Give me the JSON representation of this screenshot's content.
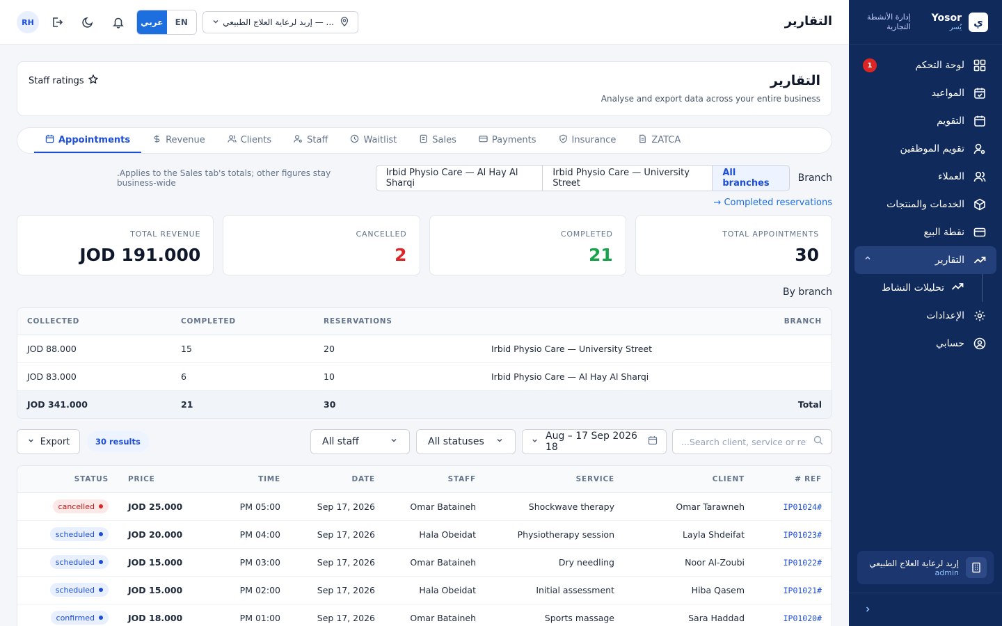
{
  "app": {
    "brand_name": "Yosor",
    "brand_name_ar": "يُسر",
    "brand_logo_glyph": "ي",
    "brand_subtitle_1": "إدارة الأنشطة",
    "brand_subtitle_2": "التجارية"
  },
  "topbar": {
    "avatar": "RH",
    "lang_ar": "عربي",
    "lang_en": "EN",
    "branch_selector": "إربد لرعاية العلاج الطبيعي — ...",
    "page_title": "التقارير"
  },
  "sidebar": {
    "items": [
      {
        "label": "لوحة التحكم",
        "icon": "dashboard-icon",
        "badge": "1"
      },
      {
        "label": "المواعيد",
        "icon": "calendar-check-icon"
      },
      {
        "label": "التقويم",
        "icon": "calendar-icon"
      },
      {
        "label": "تقويم الموظفين",
        "icon": "user-gear-icon"
      },
      {
        "label": "العملاء",
        "icon": "users-icon"
      },
      {
        "label": "الخدمات والمنتجات",
        "icon": "box-icon"
      },
      {
        "label": "نقطة البيع",
        "icon": "credit-card-icon"
      },
      {
        "label": "التقارير",
        "icon": "trending-up-icon",
        "active": true
      },
      {
        "label": "تحليلات النشاط",
        "icon": "trending-up-icon",
        "sub": true
      },
      {
        "label": "الإعدادات",
        "icon": "gear-icon"
      },
      {
        "label": "حسابي",
        "icon": "user-circle-icon"
      }
    ],
    "branch_card": {
      "name": "إربد لرعاية العلاج الطبيعي",
      "role": "admin"
    }
  },
  "header_card": {
    "title": "التقارير",
    "subtitle": "Analyse and export data across your entire business",
    "staff_ratings": "Staff ratings"
  },
  "tabs": [
    {
      "label": "Appointments",
      "icon": "calendar-icon",
      "active": true
    },
    {
      "label": "Revenue",
      "icon": "dollar-icon"
    },
    {
      "label": "Clients",
      "icon": "users-icon"
    },
    {
      "label": "Staff",
      "icon": "user-gear-icon"
    },
    {
      "label": "Waitlist",
      "icon": "clock-icon"
    },
    {
      "label": "Sales",
      "icon": "receipt-icon"
    },
    {
      "label": "Payments",
      "icon": "card-icon"
    },
    {
      "label": "Insurance",
      "icon": "shield-icon"
    },
    {
      "label": "ZATCA",
      "icon": "document-icon"
    }
  ],
  "branch_filter": {
    "note": ".Applies to the Sales tab's totals; other figures stay business-wide",
    "options": [
      "Irbid Physio Care — Al Hay Al Sharqi",
      "Irbid Physio Care — University Street",
      "All branches"
    ],
    "selected": "All branches",
    "label": "Branch"
  },
  "completed_link": "→ Completed reservations",
  "stats": [
    {
      "label": "TOTAL REVENUE",
      "value": "JOD 191.000",
      "tone": "default"
    },
    {
      "label": "CANCELLED",
      "value": "2",
      "tone": "red"
    },
    {
      "label": "COMPLETED",
      "value": "21",
      "tone": "green"
    },
    {
      "label": "TOTAL APPOINTMENTS",
      "value": "30",
      "tone": "default"
    }
  ],
  "by_branch": {
    "title": "By branch",
    "headers": {
      "collected": "COLLECTED",
      "completed": "COMPLETED",
      "reservations": "RESERVATIONS",
      "branch": "BRANCH"
    },
    "rows": [
      {
        "collected": "JOD 88.000",
        "completed": "15",
        "reservations": "20",
        "branch": "Irbid Physio Care — University Street"
      },
      {
        "collected": "JOD 83.000",
        "completed": "6",
        "reservations": "10",
        "branch": "Irbid Physio Care — Al Hay Al Sharqi"
      }
    ],
    "total": {
      "collected": "JOD 341.000",
      "completed": "21",
      "reservations": "30",
      "label": "Total"
    }
  },
  "filters": {
    "export": "Export",
    "results": "30 results",
    "staff": "All staff",
    "status": "All statuses",
    "date_range": "Aug – 17 Sep 2026 18",
    "search_placeholder": "...Search client, service or ref"
  },
  "appointments": {
    "headers": {
      "status": "STATUS",
      "price": "PRICE",
      "time": "TIME",
      "date": "DATE",
      "staff": "STAFF",
      "service": "SERVICE",
      "client": "CLIENT",
      "ref": "# REF"
    },
    "rows": [
      {
        "status": "cancelled",
        "price": "JOD 25.000",
        "time": "PM 05:00",
        "date": "Sep 17, 2026",
        "staff": "Omar Bataineh",
        "service": "Shockwave therapy",
        "client": "Omar Tarawneh",
        "ref": "IP01024#"
      },
      {
        "status": "scheduled",
        "price": "JOD 20.000",
        "time": "PM 04:00",
        "date": "Sep 17, 2026",
        "staff": "Hala Obeidat",
        "service": "Physiotherapy session",
        "client": "Layla Shdeifat",
        "ref": "IP01023#"
      },
      {
        "status": "scheduled",
        "price": "JOD 15.000",
        "time": "PM 03:00",
        "date": "Sep 17, 2026",
        "staff": "Omar Bataineh",
        "service": "Dry needling",
        "client": "Noor Al-Zoubi",
        "ref": "IP01022#"
      },
      {
        "status": "scheduled",
        "price": "JOD 15.000",
        "time": "PM 02:00",
        "date": "Sep 17, 2026",
        "staff": "Hala Obeidat",
        "service": "Initial assessment",
        "client": "Hiba Qasem",
        "ref": "IP01021#"
      },
      {
        "status": "confirmed",
        "price": "JOD 18.000",
        "time": "PM 01:00",
        "date": "Sep 17, 2026",
        "staff": "Omar Bataineh",
        "service": "Sports massage",
        "client": "Sara Haddad",
        "ref": "IP01020#"
      }
    ]
  },
  "colors": {
    "sidebar": "#102a5c",
    "accent": "#1d4ed8",
    "danger": "#dc2626",
    "success": "#16a34a"
  }
}
